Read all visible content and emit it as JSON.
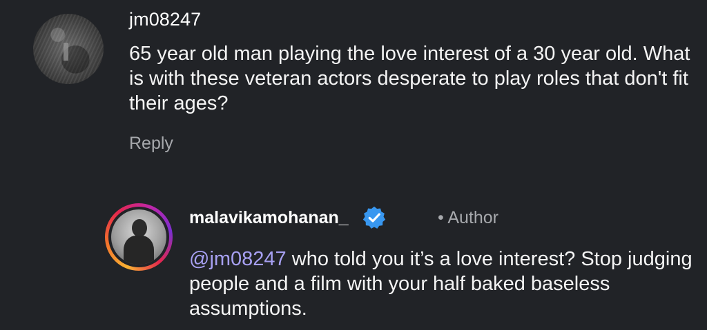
{
  "comments": [
    {
      "username": "jm08247",
      "text": "65 year old man playing the love interest of a 30 year old. What is with these veteran actors desperate to play roles that don't fit their ages?",
      "reply_label": "Reply"
    },
    {
      "username": "malavikamohanan_",
      "verified": true,
      "badge_label": "• Author",
      "mention": "@jm08247",
      "text": " who told you it’s a love interest? Stop judging people and a film with your half baked baseless assumptions."
    }
  ],
  "colors": {
    "background": "#212327",
    "mention": "#a7a0f2",
    "verified": "#3897f0",
    "secondary_text": "#a7a9ad"
  }
}
